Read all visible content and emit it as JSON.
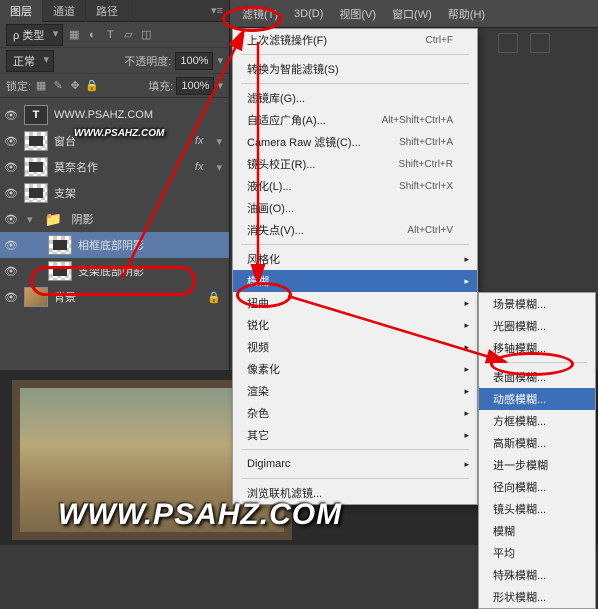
{
  "topMenu": [
    "滤镜(T)",
    "3D(D)",
    "视图(V)",
    "窗口(W)",
    "帮助(H)"
  ],
  "tabs": {
    "layers": "图层",
    "channels": "通道",
    "paths": "路径"
  },
  "typeSel": "ρ 类型",
  "normal": "正常",
  "opacity": "不透明度:",
  "opVal": "100%",
  "lock": "锁定:",
  "fill": "填充:",
  "fillVal": "100%",
  "layers_list": [
    {
      "name": "WWW.PSAHZ.COM"
    },
    {
      "name": "窗台",
      "fx": true
    },
    {
      "name": "莫奈名作",
      "fx": true
    },
    {
      "name": "支架"
    },
    {
      "name": "阴影",
      "folder": true
    },
    {
      "name": "相框底部阴影",
      "sel": true,
      "indent": true
    },
    {
      "name": "支架底部阴影",
      "indent": true
    },
    {
      "name": "背景",
      "bg": true
    }
  ],
  "dd": [
    {
      "t": "上次滤镜操作(F)",
      "s": "Ctrl+F"
    },
    {
      "sep": true
    },
    {
      "t": "转换为智能滤镜(S)"
    },
    {
      "sep": true
    },
    {
      "t": "滤镜库(G)..."
    },
    {
      "t": "自适应广角(A)...",
      "s": "Alt+Shift+Ctrl+A"
    },
    {
      "t": "Camera Raw 滤镜(C)...",
      "s": "Shift+Ctrl+A"
    },
    {
      "t": "镜头校正(R)...",
      "s": "Shift+Ctrl+R"
    },
    {
      "t": "液化(L)...",
      "s": "Shift+Ctrl+X"
    },
    {
      "t": "油画(O)..."
    },
    {
      "t": "消失点(V)...",
      "s": "Alt+Ctrl+V"
    },
    {
      "sep": true
    },
    {
      "t": "风格化",
      "sub": true
    },
    {
      "t": "模糊",
      "sub": true,
      "hi": true
    },
    {
      "t": "扭曲",
      "sub": true
    },
    {
      "t": "锐化",
      "sub": true
    },
    {
      "t": "视频",
      "sub": true
    },
    {
      "t": "像素化",
      "sub": true
    },
    {
      "t": "渲染",
      "sub": true
    },
    {
      "t": "杂色",
      "sub": true
    },
    {
      "t": "其它",
      "sub": true
    },
    {
      "sep": true
    },
    {
      "t": "Digimarc",
      "sub": true
    },
    {
      "sep": true
    },
    {
      "t": "浏览联机滤镜..."
    }
  ],
  "sub": [
    {
      "t": "场景模糊..."
    },
    {
      "t": "光圈模糊..."
    },
    {
      "t": "移轴模糊..."
    },
    {
      "sep": true
    },
    {
      "t": "表面模糊..."
    },
    {
      "t": "动感模糊...",
      "hi": true
    },
    {
      "t": "方框模糊..."
    },
    {
      "t": "高斯模糊..."
    },
    {
      "t": "进一步模糊"
    },
    {
      "t": "径向模糊..."
    },
    {
      "t": "镜头模糊..."
    },
    {
      "t": "模糊"
    },
    {
      "t": "平均"
    },
    {
      "t": "特殊模糊..."
    },
    {
      "t": "形状模糊..."
    }
  ],
  "fx_label": "fx"
}
